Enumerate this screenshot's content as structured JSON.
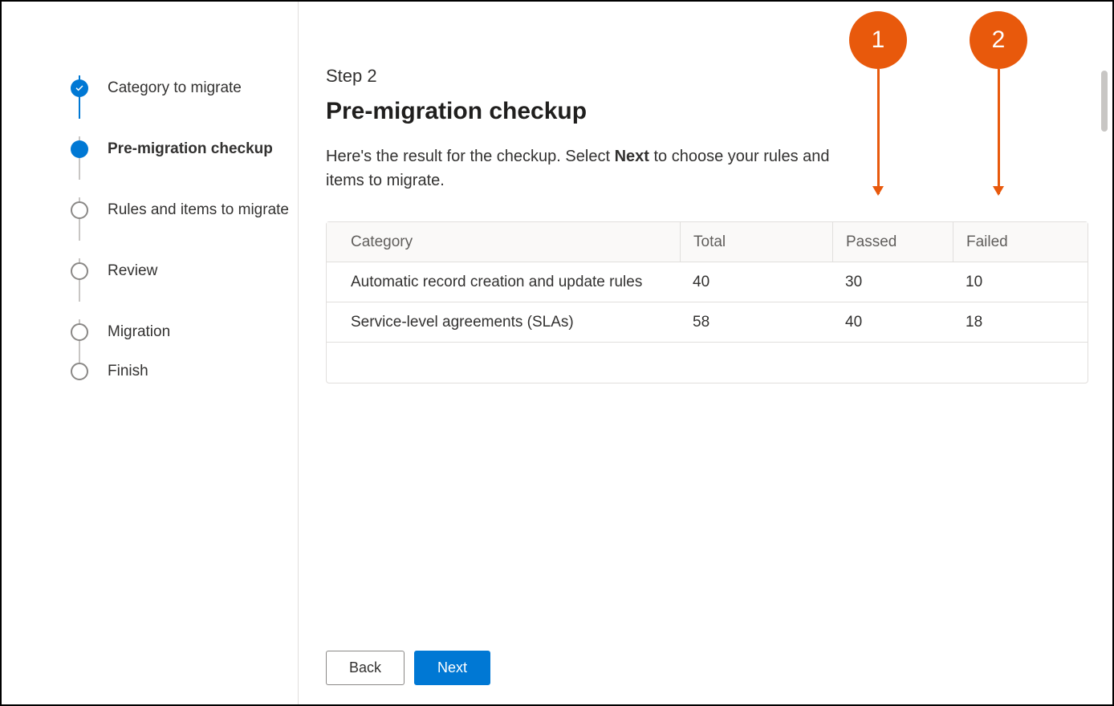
{
  "sidebar": {
    "steps": [
      {
        "label": "Category to migrate",
        "state": "completed"
      },
      {
        "label": "Pre-migration checkup",
        "state": "current"
      },
      {
        "label": "Rules and items to migrate",
        "state": "pending"
      },
      {
        "label": "Review",
        "state": "pending"
      },
      {
        "label": "Migration",
        "state": "pending"
      },
      {
        "label": "Finish",
        "state": "pending"
      }
    ]
  },
  "main": {
    "step_number": "Step 2",
    "title": "Pre-migration checkup",
    "description_pre": "Here's the result for the checkup. Select ",
    "description_bold": "Next",
    "description_post": " to choose your rules and items to migrate."
  },
  "table": {
    "headers": {
      "category": "Category",
      "total": "Total",
      "passed": "Passed",
      "failed": "Failed"
    },
    "rows": [
      {
        "category": "Automatic record creation and update rules",
        "total": "40",
        "passed": "30",
        "failed": "10"
      },
      {
        "category": "Service-level agreements (SLAs)",
        "total": "58",
        "passed": "40",
        "failed": "18"
      }
    ]
  },
  "footer": {
    "back": "Back",
    "next": "Next"
  },
  "callouts": {
    "c1": "1",
    "c2": "2"
  },
  "colors": {
    "primary": "#0078d4",
    "callout": "#e8590c"
  }
}
